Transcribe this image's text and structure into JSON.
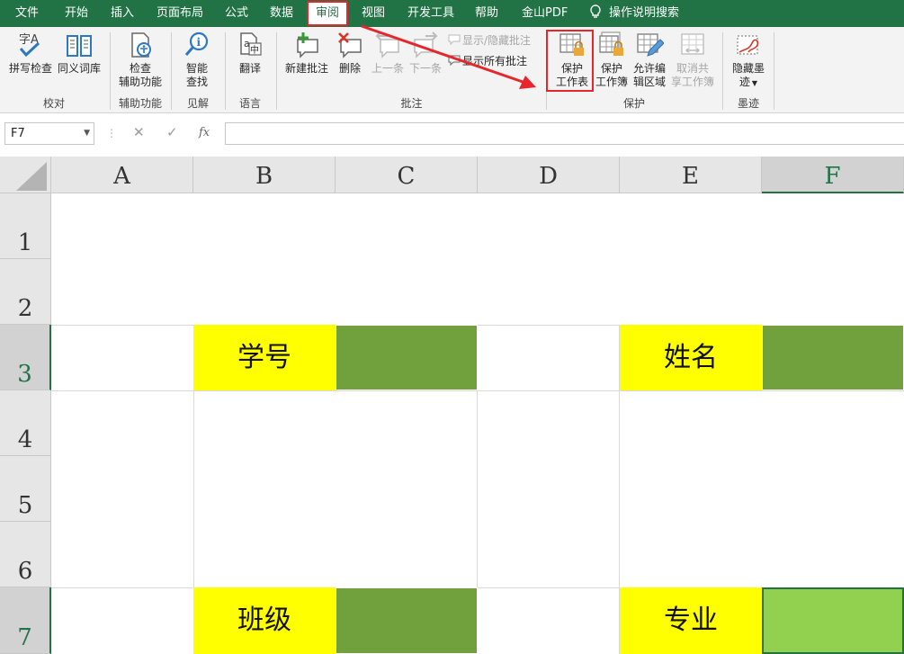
{
  "menu": {
    "tabs": [
      "文件",
      "开始",
      "插入",
      "页面布局",
      "公式",
      "数据",
      "审阅",
      "视图",
      "开发工具",
      "帮助",
      "金山PDF",
      "操作说明搜索"
    ],
    "active_tab": "审阅"
  },
  "ribbon": {
    "proofing": {
      "spell_check": "拼写检查",
      "thesaurus": "同义词库",
      "group": "校对"
    },
    "accessibility": {
      "check": "检查",
      "check2": "辅助功能",
      "group": "辅助功能"
    },
    "insights": {
      "smart": "智能",
      "lookup": "查找",
      "group": "见解"
    },
    "language": {
      "translate": "翻译",
      "group": "语言"
    },
    "comments": {
      "new": "新建批注",
      "delete": "删除",
      "previous": "上一条",
      "next": "下一条",
      "show_hide": "显示/隐藏批注",
      "show_all": "显示所有批注",
      "group": "批注"
    },
    "protect": {
      "protect_sheet_1": "保护",
      "protect_sheet_2": "工作表",
      "protect_workbook_1": "保护",
      "protect_workbook_2": "工作簿",
      "allow_edit_1": "允许编",
      "allow_edit_2": "辑区域",
      "unshare_1": "取消共",
      "unshare_2": "享工作簿",
      "group": "保护"
    },
    "ink": {
      "hide_1": "隐藏墨",
      "hide_2": "迹",
      "group": "墨迹"
    }
  },
  "formula_bar": {
    "name_box": "F7",
    "cancel": "✕",
    "enter": "✓",
    "fx": "fx",
    "formula": ""
  },
  "sheet": {
    "columns": [
      "A",
      "B",
      "C",
      "D",
      "E",
      "F"
    ],
    "rows": [
      "1",
      "2",
      "3",
      "4",
      "5",
      "6",
      "7"
    ],
    "selected_column": "F",
    "selected_row": "7",
    "cells": {
      "B3": "学号",
      "E3": "姓名",
      "B7": "班级",
      "E7": "专业"
    }
  },
  "colors": {
    "accent": "#217346",
    "highlight": "#e8252b",
    "yellow": "#ffff00",
    "green_cell": "#70a13c",
    "selected_cell": "#92d050"
  }
}
